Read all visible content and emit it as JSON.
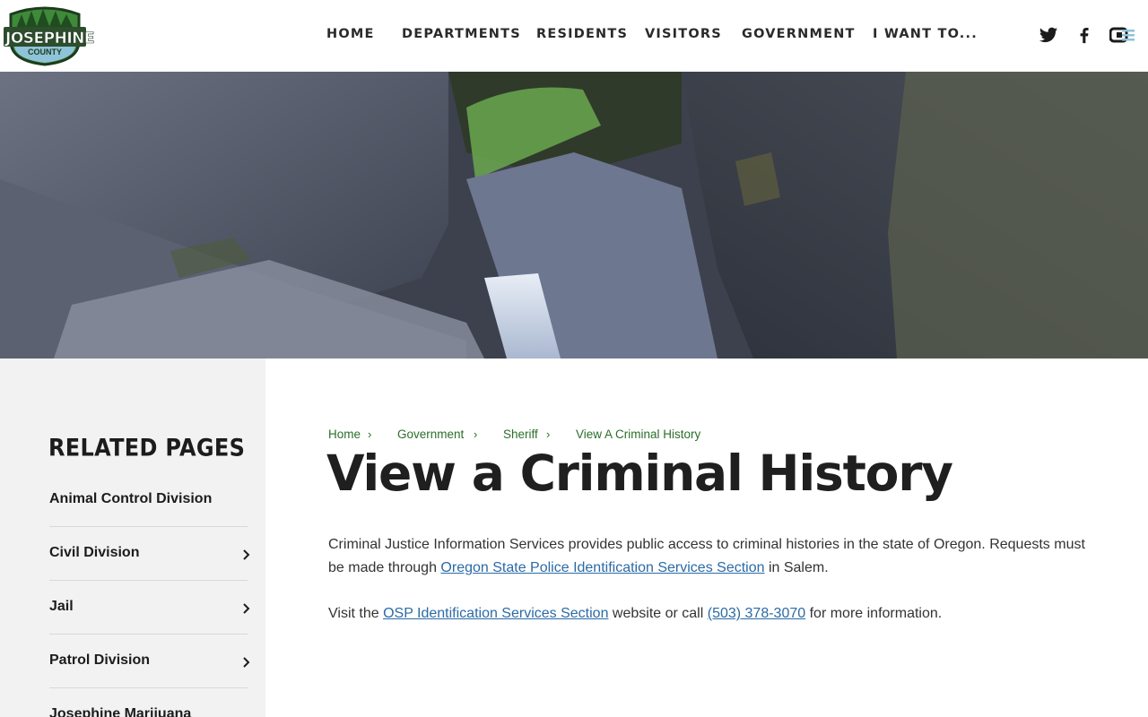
{
  "header": {
    "logo": {
      "name": "JOSEPHINE",
      "sub": "COUNTY"
    },
    "nav": [
      {
        "label": "HOME"
      },
      {
        "label": "DEPARTMENTS"
      },
      {
        "label": "RESIDENTS"
      },
      {
        "label": "VISITORS"
      },
      {
        "label": "GOVERNMENT"
      },
      {
        "label": "I WANT TO..."
      }
    ],
    "social": [
      "twitter-icon",
      "facebook-icon",
      "other-social-icon"
    ]
  },
  "sidebar": {
    "title": "RELATED PAGES",
    "items": [
      {
        "label": "Animal Control Division",
        "has_children": false
      },
      {
        "label": "Civil Division",
        "has_children": true
      },
      {
        "label": "Jail",
        "has_children": true
      },
      {
        "label": "Patrol Division",
        "has_children": true
      },
      {
        "label": "Josephine Marijuana",
        "has_children": false
      }
    ]
  },
  "breadcrumb": [
    "Home",
    "Government",
    "Sheriff",
    "View A Criminal History"
  ],
  "main": {
    "title": "View a Criminal History",
    "p1": {
      "before": "Criminal Justice Information Services provides public access to criminal histories in the state of Oregon. Requests must be made through ",
      "link": "Oregon State Police Identification Services Section",
      "after": " in Salem."
    },
    "p2": {
      "before": "Visit the ",
      "link1": "OSP Identification Services Section",
      "middle": " website or call ",
      "link2": "(503) 378-3070",
      "after": " for more information."
    }
  },
  "colors": {
    "link": "#2b6aa6",
    "breadcrumb": "#2a6e2a",
    "sidebar_bg": "#f2f2f2",
    "logo_green": "#3f8a3a"
  }
}
